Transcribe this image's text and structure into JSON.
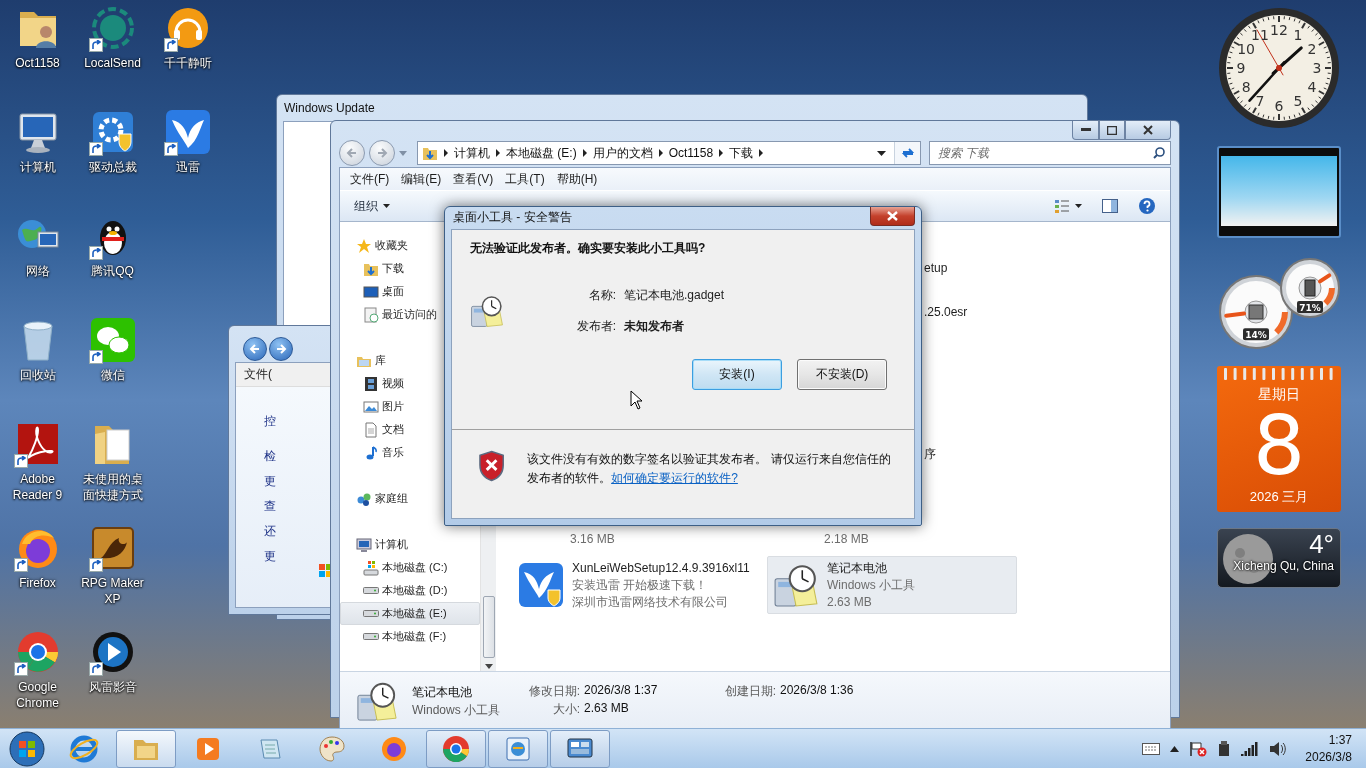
{
  "desktop_icons": [
    {
      "label": "Oct1158",
      "kind": "user-folder",
      "shortcut": false
    },
    {
      "label": "计算机",
      "kind": "computer",
      "shortcut": false
    },
    {
      "label": "网络",
      "kind": "network",
      "shortcut": false
    },
    {
      "label": "回收站",
      "kind": "recycle-bin",
      "shortcut": false
    },
    {
      "label": "Adobe Reader 9",
      "kind": "pdf",
      "shortcut": true
    },
    {
      "label": "Firefox",
      "kind": "firefox",
      "shortcut": true
    },
    {
      "label": "Google Chrome",
      "kind": "chrome",
      "shortcut": true
    },
    {
      "label": "LocalSend",
      "kind": "localsend",
      "shortcut": true
    },
    {
      "label": "驱动总裁",
      "kind": "driver",
      "shortcut": true
    },
    {
      "label": "腾讯QQ",
      "kind": "qq",
      "shortcut": true
    },
    {
      "label": "微信",
      "kind": "wechat",
      "shortcut": true
    },
    {
      "label": "未使用的桌面快捷方式",
      "kind": "folder",
      "shortcut": false
    },
    {
      "label": "RPG Maker XP",
      "kind": "rpg",
      "shortcut": true
    },
    {
      "label": "风雷影音",
      "kind": "player",
      "shortcut": true
    },
    {
      "label": "千千静听",
      "kind": "music",
      "shortcut": true
    },
    {
      "label": "迅雷",
      "kind": "bird",
      "shortcut": true
    }
  ],
  "update_window": {
    "title": "Windows Update"
  },
  "control_panel_window": {
    "menu": "文件(",
    "links": [
      "控",
      "检",
      "更",
      "查",
      "还",
      "更"
    ]
  },
  "explorer": {
    "address": [
      "计算机",
      "本地磁盘 (E:)",
      "用户的文档",
      "Oct1158",
      "下载"
    ],
    "search": {
      "placeholder": "搜索 下载"
    },
    "menu": [
      "文件(F)",
      "编辑(E)",
      "查看(V)",
      "工具(T)",
      "帮助(H)"
    ],
    "toolbar": {
      "organize": "组织"
    },
    "nav": [
      {
        "label": "收藏夹",
        "kind": "star",
        "selected": false,
        "children": [
          {
            "label": "下载",
            "kind": "download",
            "selected": false
          },
          {
            "label": "桌面",
            "kind": "desktop",
            "selected": false
          },
          {
            "label": "最近访问的",
            "kind": "recent",
            "selected": false
          }
        ]
      },
      {
        "label": "库",
        "kind": "library",
        "selected": false,
        "children": [
          {
            "label": "视频",
            "kind": "video",
            "selected": false
          },
          {
            "label": "图片",
            "kind": "pictures",
            "selected": false
          },
          {
            "label": "文档",
            "kind": "documents",
            "selected": false
          },
          {
            "label": "音乐",
            "kind": "music",
            "selected": false
          }
        ]
      },
      {
        "label": "家庭组",
        "kind": "homegroup",
        "selected": false
      },
      {
        "label": "计算机",
        "kind": "computer",
        "selected": false,
        "children": [
          {
            "label": "本地磁盘 (C:)",
            "kind": "system-drive",
            "selected": false
          },
          {
            "label": "本地磁盘 (D:)",
            "kind": "drive",
            "selected": false
          },
          {
            "label": "本地磁盘 (E:)",
            "kind": "drive",
            "selected": true
          },
          {
            "label": "本地磁盘 (F:)",
            "kind": "drive",
            "selected": false
          }
        ]
      }
    ],
    "covered_rows": [
      {
        "kind": "name-tail",
        "text": "etup"
      },
      {
        "kind": "name-tail",
        "text": ".25.0esr"
      },
      {
        "kind": "name-tail",
        "text": "序"
      },
      {
        "kind": "sizes",
        "left": "3.16 MB",
        "right": "2.18 MB"
      }
    ],
    "files": [
      {
        "name": "XunLeiWebSetup12.4.9.3916xl11",
        "lines": [
          "安装迅雷 开始极速下载！",
          "深圳市迅雷网络技术有限公司"
        ],
        "kind": "installer",
        "selected": false
      },
      {
        "name": "笔记本电池",
        "lines": [
          "Windows 小工具",
          "2.63 MB"
        ],
        "kind": "gadget",
        "selected": true
      }
    ],
    "details": {
      "name": "笔记本电池",
      "type": "Windows 小工具",
      "fields": [
        {
          "label": "修改日期:",
          "value": "2026/3/8 1:37"
        },
        {
          "label": "大小:",
          "value": "2.63 MB"
        },
        {
          "label": "创建日期:",
          "value": "2026/3/8 1:36"
        }
      ]
    }
  },
  "dialog": {
    "title": "桌面小工具 - 安全警告",
    "heading": "无法验证此发布者。确实要安装此小工具吗?",
    "fields": [
      {
        "label": "名称:",
        "value": "笔记本电池.gadget",
        "bold": false
      },
      {
        "label": "发布者:",
        "value": "未知发布者",
        "bold": true
      }
    ],
    "buttons": [
      {
        "label": "安装(I)",
        "default": true
      },
      {
        "label": "不安装(D)",
        "default": false
      }
    ],
    "warning": "该文件没有有效的数字签名以验证其发布者。 请仅运行来自您信任的发布者的软件。",
    "link": "如何确定要运行的软件?"
  },
  "gadgets": {
    "clock": {
      "numerals": [
        "12",
        "11",
        "1",
        "10",
        "2",
        "9",
        "3",
        "8",
        "4",
        "7",
        "5",
        "6"
      ]
    },
    "meters": [
      {
        "kind": "cpu",
        "reading": "14%",
        "level": 0.14
      },
      {
        "kind": "memory",
        "reading": "71%",
        "level": 0.71
      }
    ],
    "calendar": {
      "weekday": "星期日",
      "day": "8",
      "month_year": "2026 三月"
    },
    "weather": {
      "temperature": "4°",
      "location": "Xicheng Qu, China"
    }
  },
  "taskbar": {
    "items": [
      {
        "kind": "browser-e",
        "open": false,
        "active": false
      },
      {
        "kind": "explorer",
        "open": true,
        "active": true
      },
      {
        "kind": "media",
        "open": false,
        "active": false
      },
      {
        "kind": "notepad",
        "open": false,
        "active": false
      },
      {
        "kind": "paint",
        "open": false,
        "active": false
      },
      {
        "kind": "firefox",
        "open": false,
        "active": false
      },
      {
        "kind": "chrome",
        "open": true,
        "active": false
      },
      {
        "kind": "update",
        "open": true,
        "active": false
      },
      {
        "kind": "gadget",
        "open": true,
        "active": false
      }
    ],
    "tray": {
      "time": "1:37",
      "date": "2026/3/8"
    }
  }
}
